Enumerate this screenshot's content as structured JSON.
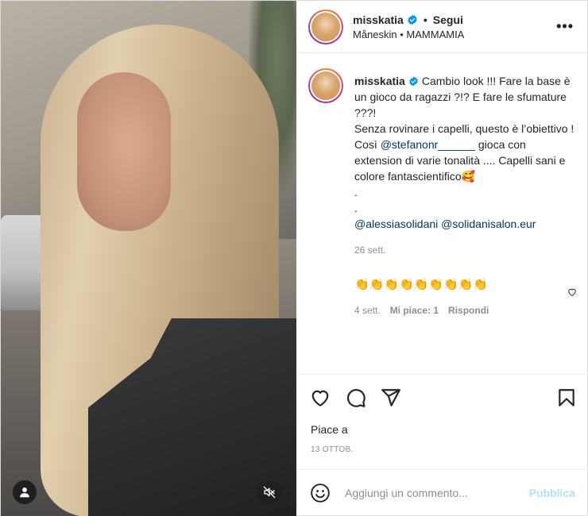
{
  "post": {
    "username": "misskatia",
    "follow_label": "Segui",
    "separator": "•",
    "audio": "Måneskin • MAMMAMIA",
    "more": "•••"
  },
  "caption": {
    "username": "misskatia",
    "lines": [
      "Cambio look !!! Fare la base è un gioco da ragazzi ?!? E fare le sfumature ???!",
      "Senza rovinare i capelli, questo è l’obiettivo ! Così ",
      " gioca con extension di varie tonalità .... Capelli sani e colore fantascientifico🥰",
      ".",
      "."
    ],
    "mention_1": "@stefanonr______",
    "mention_2": "@alessiasolidani",
    "mention_3": "@solidanisalon.eur",
    "time": "26 sett."
  },
  "comment": {
    "text": "👏👏👏👏👏👏👏👏👏",
    "time": "4 sett.",
    "likes": "Mi piace: 1",
    "reply": "Rispondi"
  },
  "likes_text": "Piace a",
  "date": "13 OTTOB.",
  "input": {
    "placeholder": "Aggiungi un commento...",
    "publish_label": "Pubblica"
  },
  "colors": {
    "link": "#00376b",
    "verified": "#0095f6",
    "publish_disabled": "#b2dffc"
  },
  "icons": {
    "like": "heart-icon",
    "comment": "comment-icon",
    "share": "paper-plane-icon",
    "save": "bookmark-icon",
    "emoji": "smiley-icon",
    "mute": "speaker-muted-icon",
    "tagged": "person-icon"
  }
}
